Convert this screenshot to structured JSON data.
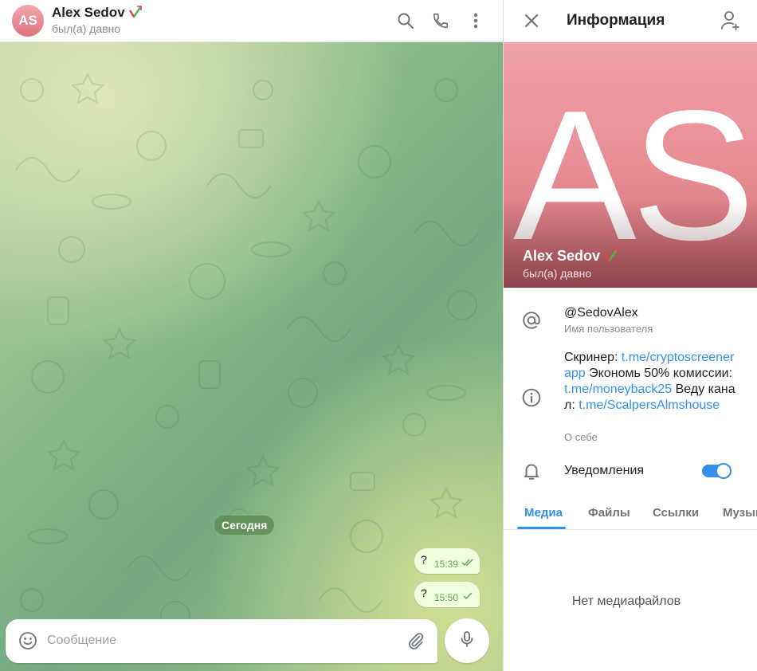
{
  "chat": {
    "header": {
      "avatar_initials": "AS",
      "title": "Alex Sedov",
      "status": "был(а) давно",
      "icons": [
        "search-icon",
        "phone-icon",
        "more-vertical-icon"
      ]
    },
    "date_separator": "Сегодня",
    "messages": [
      {
        "text": "?",
        "time": "15:39",
        "status": "read"
      },
      {
        "text": "?",
        "time": "15:50",
        "status": "sent"
      }
    ],
    "composer": {
      "placeholder": "Сообщение",
      "icons": [
        "smile-icon",
        "paperclip-icon",
        "microphone-icon"
      ]
    }
  },
  "info": {
    "title": "Информация",
    "avatar_initials": "AS",
    "name": "Alex Sedov",
    "status": "был(а) давно",
    "username": "@SedovAlex",
    "username_label": "Имя пользователя",
    "bio": {
      "parts": [
        {
          "t": "Скринер: "
        },
        {
          "t": "t.me/cryptoscreenerapp",
          "link": true
        },
        {
          "t": " Экономь 50% комиссии: "
        },
        {
          "t": "t.me/moneyback25",
          "link": true
        },
        {
          "t": " Веду канал: "
        },
        {
          "t": "t.me/ScalpersAlmshouse",
          "link": true
        }
      ],
      "label": "О себе"
    },
    "notifications": {
      "label": "Уведомления",
      "enabled": true
    },
    "tabs": [
      "Медиа",
      "Файлы",
      "Ссылки",
      "Музыка"
    ],
    "active_tab": 0,
    "empty_text": "Нет медиафайлов"
  },
  "colors": {
    "accent": "#3390ec",
    "avatar": "#e78b92",
    "bubble": "#effdde",
    "read_check": "#5fad56"
  }
}
